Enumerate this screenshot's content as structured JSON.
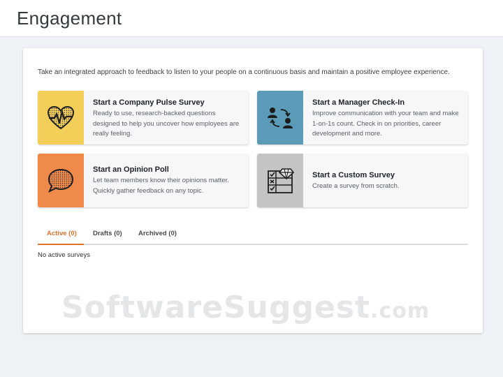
{
  "header": {
    "title": "Engagement"
  },
  "intro": "Take an integrated approach to feedback to listen to your people on a continuous basis and maintain a positive employee experience.",
  "tiles": [
    {
      "title": "Start a Company Pulse Survey",
      "desc": "Ready to use, research-backed questions designed to help you uncover how employees are really feeling.",
      "icon": "heart-pulse-icon",
      "color": "#f3cf5a"
    },
    {
      "title": "Start a Manager Check-In",
      "desc": "Improve communication with your team and make 1-on-1s count. Check in on priorities, career development and more.",
      "icon": "people-exchange-icon",
      "color": "#5b9bb8"
    },
    {
      "title": "Start an Opinion Poll",
      "desc": "Let team members know their opinions matter. Quickly gather feedback on any topic.",
      "icon": "speech-bubble-icon",
      "color": "#f08a4b"
    },
    {
      "title": "Start a Custom Survey",
      "desc": "Create a survey from scratch.",
      "icon": "checklist-diamond-icon",
      "color": "#c4c4c4"
    }
  ],
  "tabs": [
    {
      "label": "Active (0)",
      "active": true
    },
    {
      "label": "Drafts (0)",
      "active": false
    },
    {
      "label": "Archived (0)",
      "active": false
    }
  ],
  "empty_state": "No active surveys",
  "watermark": {
    "main": "SoftwareSuggest",
    "suffix": ".com"
  }
}
